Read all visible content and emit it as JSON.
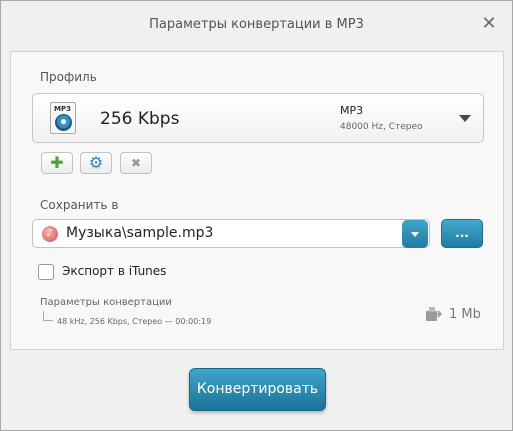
{
  "window": {
    "title": "Параметры конвертации в MP3",
    "close_symbol": "✕"
  },
  "profile": {
    "label": "Профиль",
    "icon_tag": "MP3",
    "name": "256 Kbps",
    "format": "MP3",
    "format_detail": "48000 Hz,  Стерео"
  },
  "profile_buttons": {
    "add_symbol": "✚",
    "settings_symbol": "⚙",
    "delete_symbol": "✖"
  },
  "save": {
    "label": "Сохранить в",
    "path": "Музыка\\sample.mp3",
    "browse_label": "..."
  },
  "itunes": {
    "label": "Экспорт в iTunes",
    "checked": false
  },
  "summary": {
    "title": "Параметры конвертации",
    "detail": "48 kHz, 256 Kbps, Стерео — 00:00:19",
    "size": "1 Mb"
  },
  "convert_button": {
    "label": "Конвертировать"
  },
  "colors": {
    "accent": "#2a8db5",
    "add_green": "#4aa532",
    "settings_blue": "#2f83c1"
  }
}
